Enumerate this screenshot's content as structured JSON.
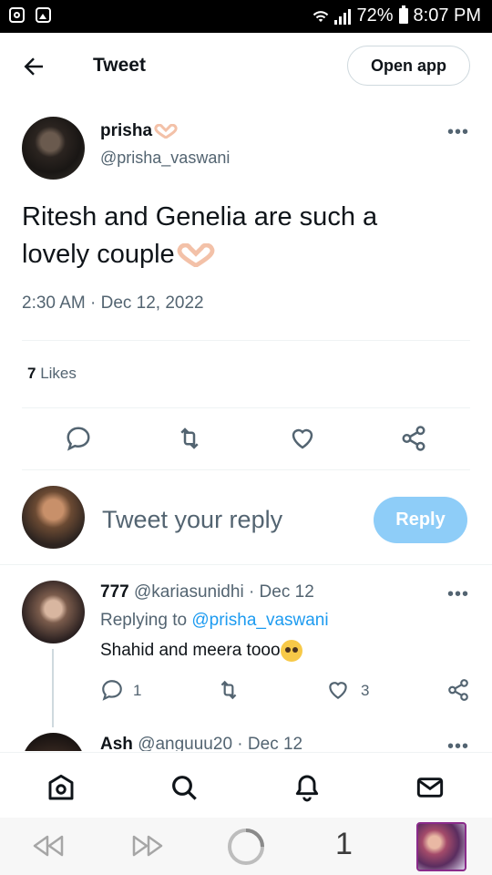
{
  "status_bar": {
    "battery": "72%",
    "time": "8:07 PM"
  },
  "header": {
    "title": "Tweet",
    "open_app": "Open app"
  },
  "tweet": {
    "author_name": "prisha",
    "handle": "@prisha_vaswani",
    "text": "Ritesh and Genelia are such a lovely couple",
    "timestamp": "2:30 AM · Dec 12, 2022",
    "likes_count": "7",
    "likes_label": "Likes"
  },
  "reply_box": {
    "placeholder": "Tweet your reply",
    "button": "Reply"
  },
  "replies": [
    {
      "name": "777",
      "handle": "@kariasunidhi",
      "date": "· Dec 12",
      "replying_to_label": "Replying to",
      "replying_to": "@prisha_vaswani",
      "text": "Shahid and meera tooo",
      "reply_count": "1",
      "like_count": "3"
    },
    {
      "name": "Ash",
      "handle": "@anguuu20",
      "date": "· Dec 12"
    }
  ],
  "browser_bar": {
    "page_number": "1"
  },
  "colors": {
    "accent": "#1d9bf0",
    "reply_button": "#8ecdf8",
    "muted_text": "#536471"
  }
}
